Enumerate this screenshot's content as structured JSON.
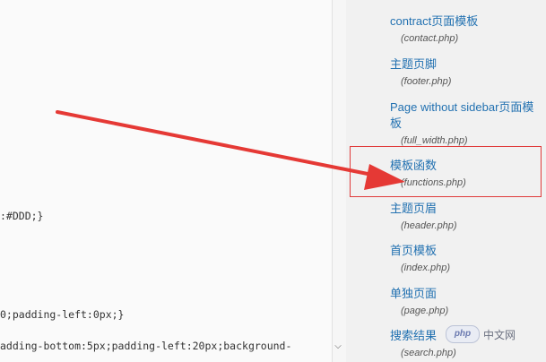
{
  "editor": {
    "lines": [
      ":#DDD;}",
      "0;padding-left:0px;}",
      "adding-bottom:5px;padding-left:20px;background-"
    ]
  },
  "sidebar": {
    "items": [
      {
        "label": "contract页面模板",
        "file": "(contact.php)"
      },
      {
        "label": "主题页脚",
        "file": "(footer.php)"
      },
      {
        "label": "Page without sidebar页面模",
        "label2": "板",
        "file": "(full_width.php)"
      },
      {
        "label": "模板函数",
        "file": "(functions.php)"
      },
      {
        "label": "主题页眉",
        "file": "(header.php)"
      },
      {
        "label": "首页模板",
        "file": "(index.php)"
      },
      {
        "label": "单独页面",
        "file": "(page.php)"
      },
      {
        "label": "搜索结果",
        "file": "(search.php)"
      }
    ]
  },
  "colors": {
    "link": "#2271b1",
    "highlight": "#e03b3b"
  },
  "watermark": {
    "logo": "php",
    "text": "中文网"
  },
  "scroll_icon": "chevron-down-icon"
}
